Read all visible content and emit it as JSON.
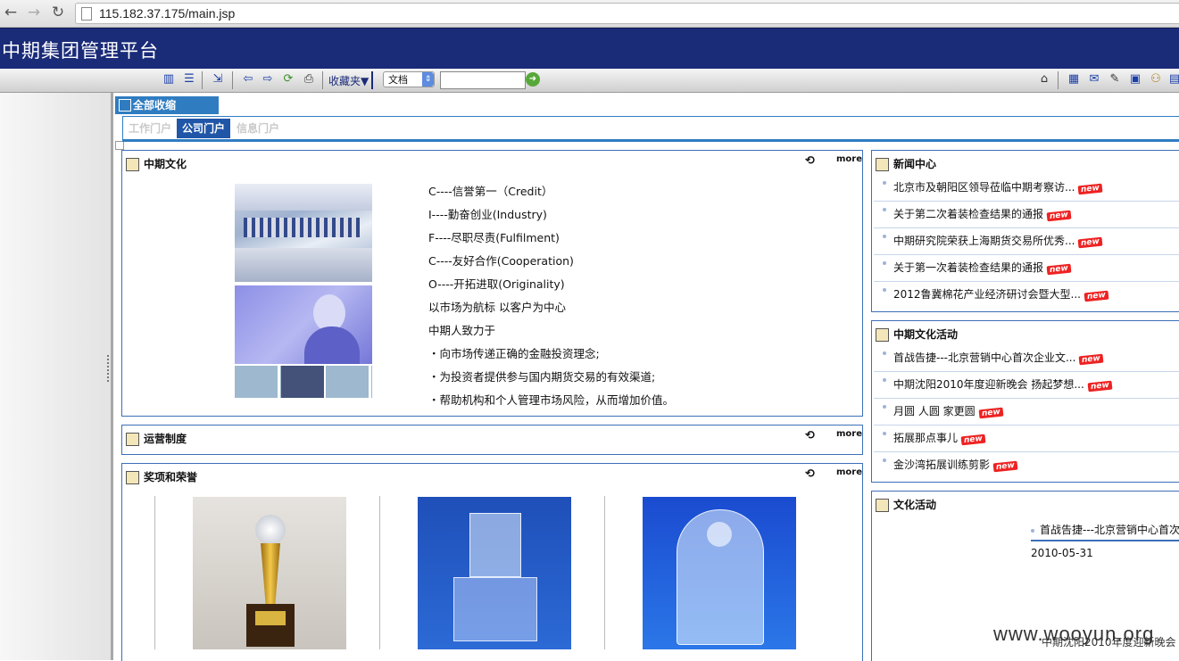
{
  "browser": {
    "url": "115.182.37.175/main.jsp"
  },
  "app": {
    "title": "中期集团管理平台"
  },
  "toolbar": {
    "favorites": "收藏夹▼",
    "search_type": "文档",
    "search_placeholder": ""
  },
  "collapse_all": "全部收缩",
  "tabs": [
    "工作门户",
    "公司门户",
    "信息门户"
  ],
  "more_label": "more",
  "culture": {
    "title": "中期文化",
    "lines": [
      "C----信誉第一（Credit）",
      "I----勤奋创业(Industry)",
      "F----尽职尽责(Fulfilment)",
      "C----友好合作(Cooperation)",
      "O----开拓进取(Originality)",
      "以市场为航标 以客户为中心",
      "中期人致力于",
      "・向市场传递正确的金融投资理念;",
      "・为投资者提供参与国内期货交易的有效渠道;",
      "・帮助机构和个人管理市场风险，从而增加价值。"
    ]
  },
  "operations": {
    "title": "运营制度"
  },
  "awards": {
    "title": "奖项和荣誉"
  },
  "news": {
    "title": "新闻中心",
    "items": [
      "北京市及朝阳区领导莅临中期考察访...",
      "关于第二次着装检查结果的通报",
      "中期研究院荣获上海期货交易所优秀...",
      "关于第一次着装检查结果的通报",
      "2012鲁冀棉花产业经济研讨会暨大型..."
    ]
  },
  "culture_activities": {
    "title": "中期文化活动",
    "items": [
      "首战告捷---北京营销中心首次企业文...",
      "中期沈阳2010年度迎新晚会 扬起梦想...",
      "月圆 人圆 家更圆",
      "拓展那点事儿",
      "金沙湾拓展训练剪影"
    ]
  },
  "activities": {
    "title": "文化活动",
    "marquee": "首战告捷---北京营销中心首次",
    "date": "2010-05-31",
    "footer": "中期沈阳2010年度迎新晚会"
  },
  "new_badge": "new",
  "watermark": "www.wooyun.org"
}
